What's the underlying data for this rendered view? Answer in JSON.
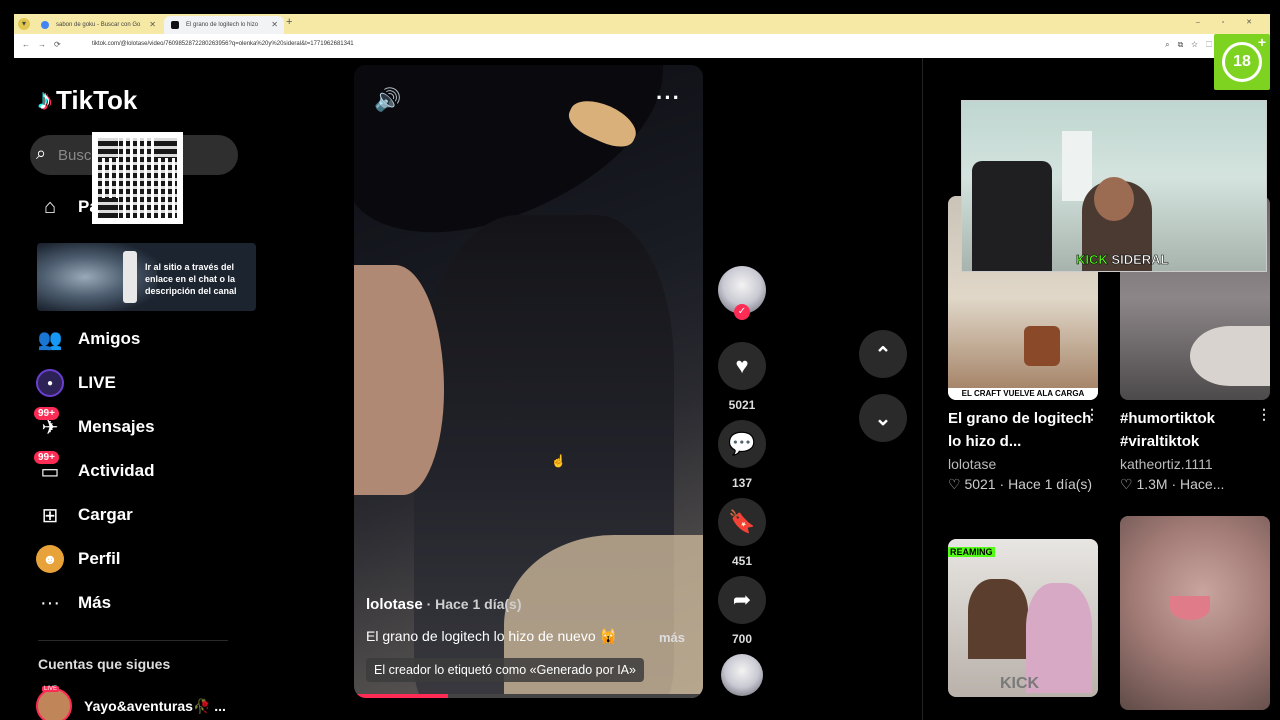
{
  "browser": {
    "tabs": [
      {
        "title": "sabon de goku - Buscar con Go"
      },
      {
        "title": "El grano de logitech lo hizo"
      }
    ],
    "new_tab": "+",
    "url": "tiktok.com/@lolotase/video/7609852872280263956?q=olenka%20y%20sideral&t=1771962681341",
    "window_controls": "– ▫ ✕"
  },
  "age_badge": {
    "label": "18",
    "plus": "+"
  },
  "sidebar": {
    "logo": "TikTok",
    "search_placeholder": "Busca",
    "promo_text": "Ir al sitio a través del enlace en el chat o la descripción del canal",
    "nav": [
      {
        "label": "Pa",
        "icon": "home-icon"
      },
      {
        "label": "Amigos",
        "icon": "friends-icon"
      },
      {
        "label": "LIVE",
        "icon": "live-icon"
      },
      {
        "label": "Mensajes",
        "icon": "messages-icon",
        "badge": "99+"
      },
      {
        "label": "Actividad",
        "icon": "activity-icon",
        "badge": "99+"
      },
      {
        "label": "Cargar",
        "icon": "upload-icon"
      },
      {
        "label": "Perfil",
        "icon": "profile-icon"
      },
      {
        "label": "Más",
        "icon": "more-icon"
      }
    ],
    "following_title": "Cuentas que sigues",
    "following": [
      {
        "name": "Yayo&aventuras🥀 ...",
        "live": "LIVE"
      }
    ]
  },
  "video": {
    "author": "lolotase",
    "time": " · Hace 1 día(s)",
    "caption": "El grano de logitech lo hizo de nuevo 🙀",
    "more": "más",
    "ai_label": "El creador lo etiquetó como «Generado por IA»",
    "progress": 0.27
  },
  "actions": {
    "likes": "5021",
    "comments": "137",
    "saves": "451",
    "shares": "700"
  },
  "webcam": {
    "brand": "KICK",
    "name": "SIDERAL"
  },
  "recommendations": [
    {
      "title": "El grano de logitech lo hizo d...",
      "user": "lolotase",
      "likes": "5021",
      "time": "Hace 1 día(s)",
      "thumb_caption": "EL CRAFT VUELVE ALA CARGA"
    },
    {
      "title": "#humortiktok #viraltiktok",
      "user": "katheortiz.1111",
      "likes": "1.3M",
      "time": "Hace..."
    },
    {
      "thumb_tag": "REAMING",
      "thumb_brand": "KICK"
    },
    {}
  ],
  "colors": {
    "accent": "#fe2c55",
    "cyan": "#25f4ee",
    "kick_green": "#53fc18",
    "age_green": "#7ed321"
  }
}
